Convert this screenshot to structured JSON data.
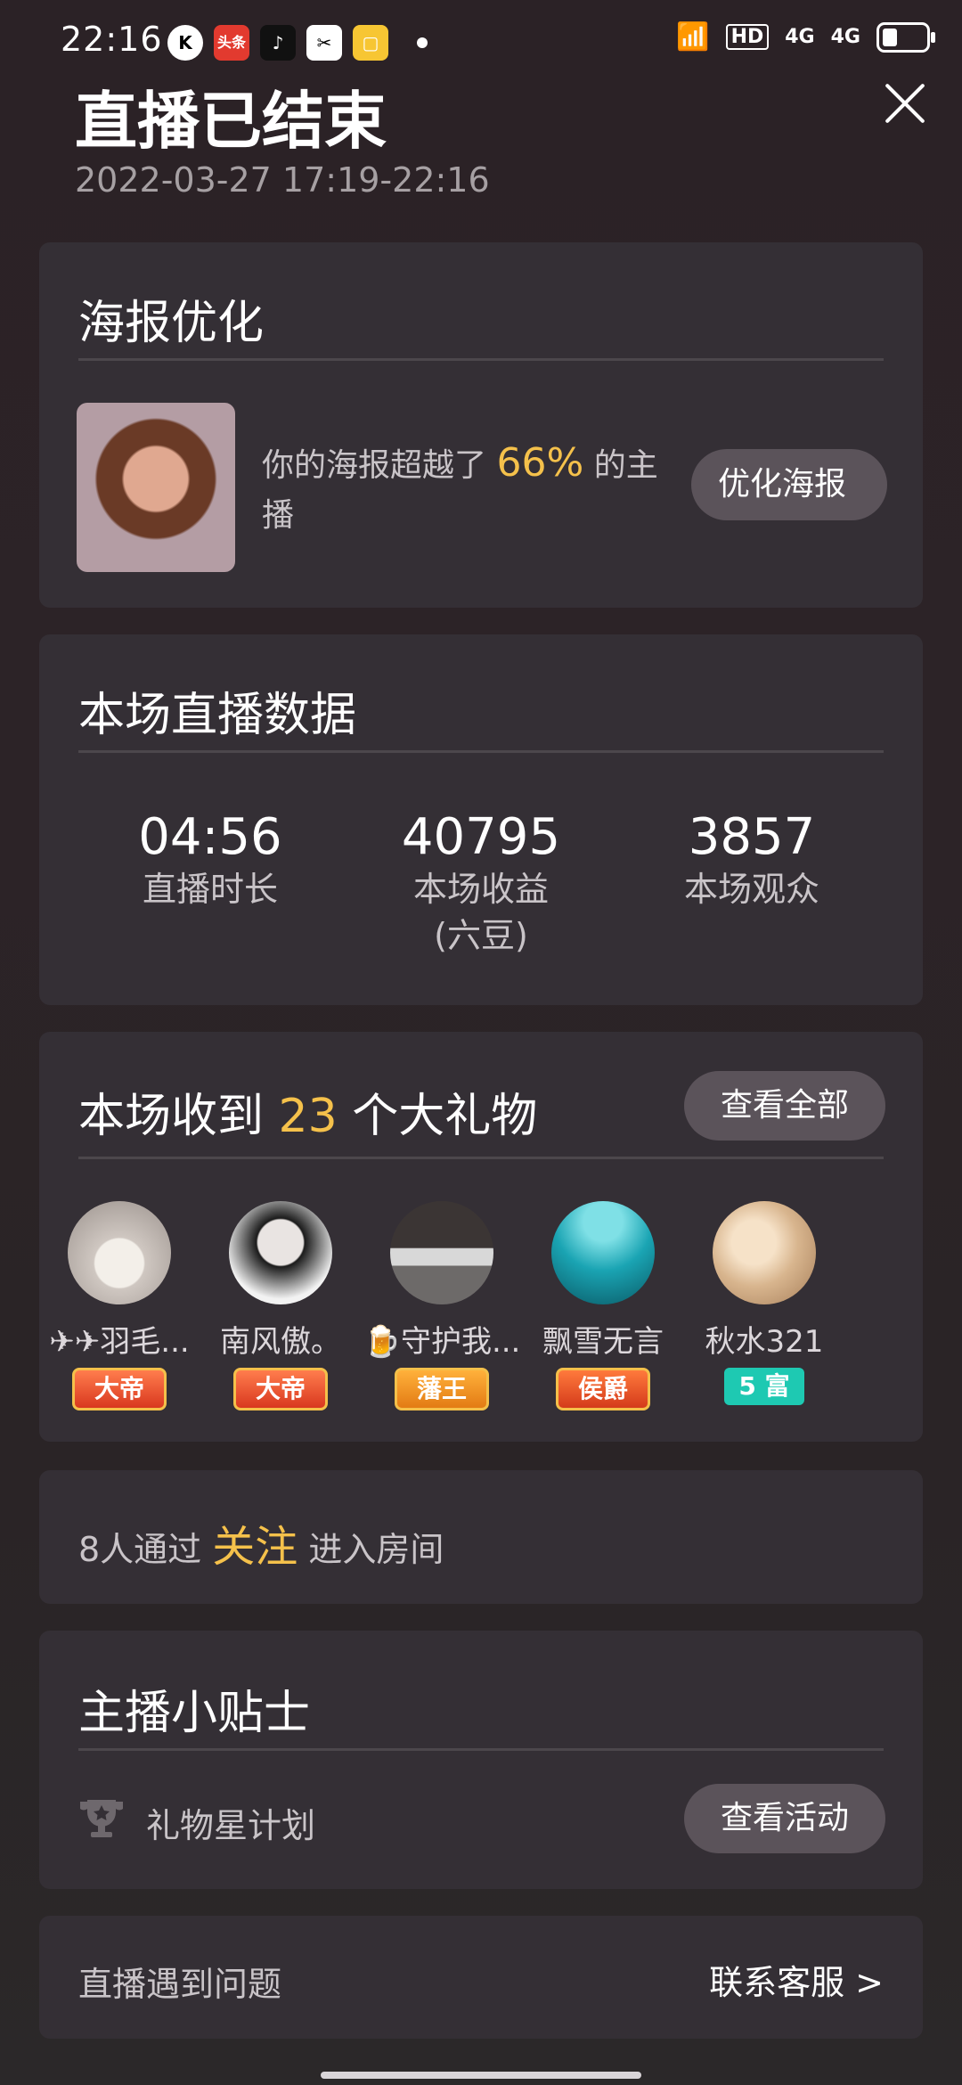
{
  "status_bar": {
    "time": "22:16",
    "apps": [
      "K",
      "头条",
      "♪",
      "✂",
      "▢"
    ],
    "hd": "HD",
    "net1": "4G",
    "net2": "4G"
  },
  "header": {
    "title": "直播已结束",
    "time_range": "2022-03-27 17:19-22:16"
  },
  "poster": {
    "title": "海报优化",
    "text_before": "你的海报超越了",
    "percent": "66%",
    "text_after": "的主播",
    "button": "优化海报"
  },
  "live_data": {
    "title": "本场直播数据",
    "stats": [
      {
        "value": "04:56",
        "label": "直播时长"
      },
      {
        "value": "40795",
        "label": "本场收益\n(六豆)"
      },
      {
        "value": "3857",
        "label": "本场观众"
      }
    ]
  },
  "gifts": {
    "title_before": "本场收到",
    "count": "23",
    "title_after": "个大礼物",
    "button": "查看全部",
    "users": [
      {
        "name": "✈✈羽毛...",
        "badge": "大帝",
        "color": "#cfc7c1"
      },
      {
        "name": "南风傲。",
        "badge": "大帝",
        "color": "#1b1b1b"
      },
      {
        "name": "🍺守护我...",
        "badge": "藩王",
        "color": "#6d6a69"
      },
      {
        "name": "飘雪无言",
        "badge": "侯爵",
        "color": "#1b7e8c"
      },
      {
        "name": "秋水321",
        "badge": "5 富",
        "color": "#d8b58e"
      }
    ]
  },
  "follow": {
    "prefix": "8人通过",
    "highlight": "关注",
    "suffix": "进入房间"
  },
  "tips": {
    "title": "主播小贴士",
    "item_label": "礼物星计划",
    "button": "查看活动"
  },
  "problem": {
    "label": "直播遇到问题",
    "link": "联系客服 >"
  }
}
